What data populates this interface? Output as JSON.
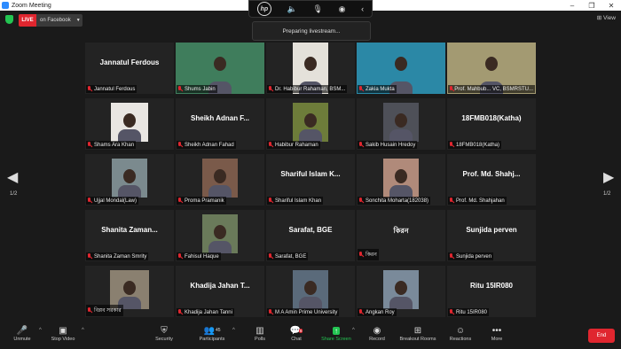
{
  "window": {
    "title": "Zoom Meeting"
  },
  "topbar": {
    "live_label": "LIVE",
    "stream_label": "on Facebook",
    "view_label": "View"
  },
  "hp_toolbar": {
    "logo": "hp"
  },
  "toast": {
    "text": "Preparing livestream..."
  },
  "pagination": {
    "left_page": "1/2",
    "right_page": "1/2"
  },
  "participants": [
    {
      "name": "Jannatul Ferdous",
      "label": "Jannatul Ferdous",
      "video": false
    },
    {
      "name": "",
      "label": "Shums Jabin",
      "video": true,
      "bg": "#3a8a5a"
    },
    {
      "name": "",
      "label": "Dr. Habibur Rahaman, BSM...",
      "video": true,
      "bg": "#d9d6cf"
    },
    {
      "name": "",
      "label": "Zakia Mukta",
      "video": true,
      "bg": "#2a8aa0"
    },
    {
      "name": "",
      "label": "Prof. Mahbub... VC, BSMRSTU...",
      "video": true,
      "bg": "#a9a07a",
      "active": true
    },
    {
      "name": "",
      "label": "Shams Ara Khan",
      "video": true,
      "bg": "#232323"
    },
    {
      "name": "Sheikh Adnan F...",
      "label": "Sheikh Adnan Fahad",
      "video": false
    },
    {
      "name": "",
      "label": "Habibur Rahaman",
      "video": true,
      "bg": "#232323"
    },
    {
      "name": "",
      "label": "Sakib Husain Hredoy",
      "video": true,
      "bg": "#232323"
    },
    {
      "name": "18FMB018(Katha)",
      "label": "18FMB018(Katha)",
      "video": false
    },
    {
      "name": "",
      "label": "Ujjal Mondal(Law)",
      "video": true,
      "bg": "#232323"
    },
    {
      "name": "",
      "label": "Proma Pramanik",
      "video": true,
      "bg": "#232323"
    },
    {
      "name": "Shariful Islam K...",
      "label": "Shariful Islam Khan",
      "video": false
    },
    {
      "name": "",
      "label": "Sonchita Moharta(182038)",
      "video": true,
      "bg": "#232323"
    },
    {
      "name": "Prof. Md. Shahj...",
      "label": "Prof. Md. Shahjahan",
      "video": false
    },
    {
      "name": "Shanita Zaman...",
      "label": "Shanita Zaman Smrity",
      "video": false
    },
    {
      "name": "",
      "label": "Fahisul Haque",
      "video": true,
      "bg": "#232323"
    },
    {
      "name": "Sarafat, BGE",
      "label": "Sarafat, BGE",
      "video": false
    },
    {
      "name": "কিরন",
      "label": "কিরন",
      "video": false
    },
    {
      "name": "Sunjida perven",
      "label": "Sunjida perven",
      "video": false
    },
    {
      "name": "",
      "label": "বিপ্লব সরকার",
      "video": true,
      "bg": "#232323"
    },
    {
      "name": "Khadija Jahan T...",
      "label": "Khadija Jahan Tanni",
      "video": false
    },
    {
      "name": "",
      "label": "M A Amin Prime University",
      "video": true,
      "bg": "#232323"
    },
    {
      "name": "",
      "label": "Angkan Roy",
      "video": true,
      "bg": "#232323"
    },
    {
      "name": "Ritu 15IR080",
      "label": "Ritu 15IR080",
      "video": false
    }
  ],
  "toolbar": {
    "unmute": "Unmute",
    "stop_video": "Stop Video",
    "security": "Security",
    "participants": "Participants",
    "participants_count": "45",
    "polls": "Polls",
    "chat": "Chat",
    "chat_badge": "6",
    "share_screen": "Share Screen",
    "record": "Record",
    "breakout": "Breakout Rooms",
    "reactions": "Reactions",
    "more": "More",
    "end": "End"
  },
  "colors": {
    "live_red": "#e0262f",
    "share_green": "#23c552",
    "active_outline": "#d8e05a"
  }
}
